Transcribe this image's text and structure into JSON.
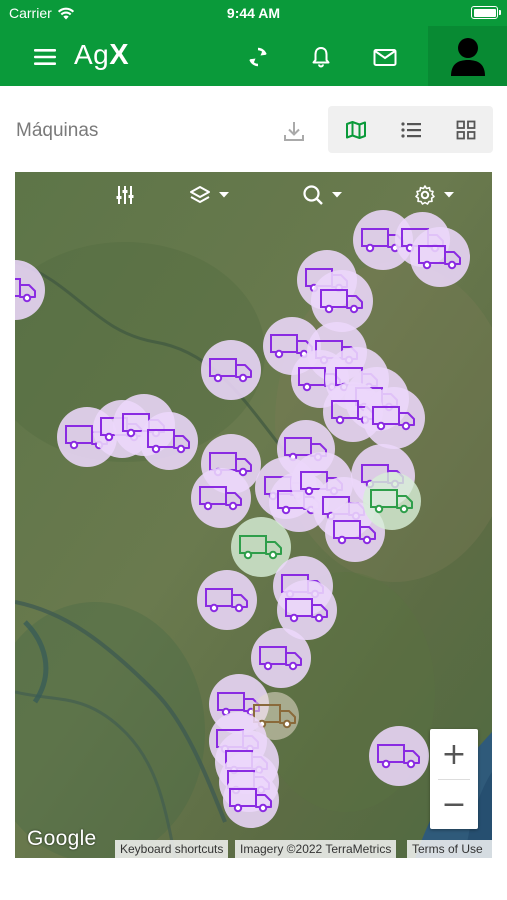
{
  "status_bar": {
    "carrier": "Carrier",
    "time": "9:44 AM"
  },
  "app_bar": {
    "logo_prefix": "Ag",
    "logo_suffix": "X",
    "icons": [
      "menu-icon",
      "sync-icon",
      "bell-icon",
      "mail-icon",
      "user-avatar-icon"
    ]
  },
  "toolbar": {
    "title": "Máquinas",
    "download_icon": "download-icon",
    "views": [
      {
        "icon": "map-icon",
        "active": true
      },
      {
        "icon": "list-icon",
        "active": false
      },
      {
        "icon": "grid-icon",
        "active": false
      }
    ]
  },
  "map": {
    "controls": [
      "filter-sliders-icon",
      "layers-icon",
      "search-icon",
      "settings-gear-icon"
    ],
    "zoom_in": "+",
    "zoom_out": "−",
    "google_logo": "Google",
    "attribution": {
      "shortcuts": "Keyboard shortcuts",
      "imagery": "Imagery ©2022 TerraMetrics",
      "terms": "Terms of Use"
    },
    "marker_colors": {
      "purple": "#8a2be2",
      "green": "#2e9e4a",
      "brown": "#8a6a3a"
    }
  },
  "colors": {
    "brand_green": "#0a9a3a",
    "active_view": "#0a9a3a",
    "inactive_icon": "#555555"
  }
}
